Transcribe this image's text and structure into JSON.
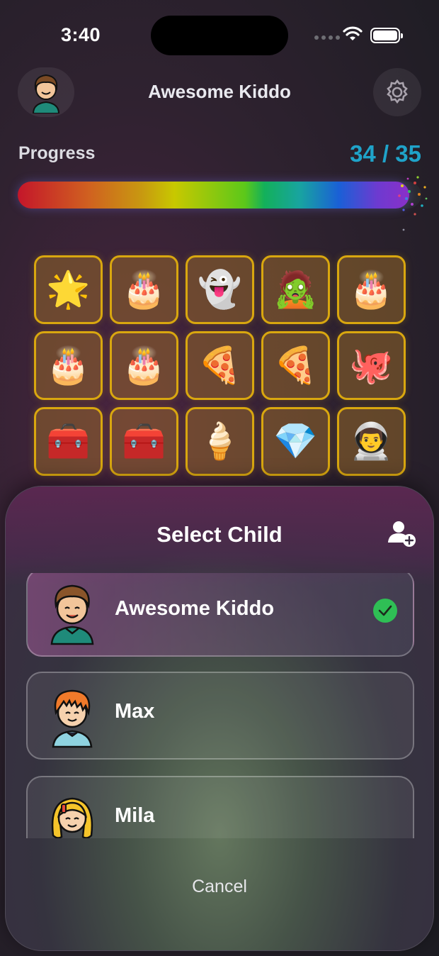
{
  "status_bar": {
    "time": "3:40"
  },
  "header": {
    "title": "Awesome Kiddo",
    "avatar_icon": "boy-avatar-icon",
    "settings_icon": "gear-icon"
  },
  "progress": {
    "label": "Progress",
    "count": "34 / 35",
    "value": 34,
    "total": 35,
    "fraction": 0.971
  },
  "stickers": [
    {
      "emoji": "🌟",
      "icon": "star-icon"
    },
    {
      "emoji": "🎂",
      "icon": "cake-icon"
    },
    {
      "emoji": "👻",
      "icon": "ghost-icon"
    },
    {
      "emoji": "🧟",
      "icon": "zombie-icon"
    },
    {
      "emoji": "🎂",
      "icon": "cake-icon"
    },
    {
      "emoji": "🎂",
      "icon": "cake-icon"
    },
    {
      "emoji": "🎂",
      "icon": "cake-icon"
    },
    {
      "emoji": "🍕",
      "icon": "pizza-icon"
    },
    {
      "emoji": "🍕",
      "icon": "pizza-icon"
    },
    {
      "emoji": "🐙",
      "icon": "octopus-icon"
    },
    {
      "emoji": "🧰",
      "icon": "treasure-chest-icon"
    },
    {
      "emoji": "🧰",
      "icon": "treasure-chest-icon"
    },
    {
      "emoji": "🍦",
      "icon": "ice-cream-icon"
    },
    {
      "emoji": "💎",
      "icon": "crystal-icon"
    },
    {
      "emoji": "👨‍🚀",
      "icon": "astronaut-icon"
    }
  ],
  "sheet": {
    "title": "Select Child",
    "add_icon": "add-person-icon",
    "children": [
      {
        "name": "Awesome Kiddo",
        "selected": true,
        "avatar": "boy-brown-hair-icon"
      },
      {
        "name": "Max",
        "selected": false,
        "avatar": "boy-orange-hair-icon"
      },
      {
        "name": "Mila",
        "selected": false,
        "avatar": "girl-blonde-hair-icon"
      }
    ],
    "cancel": "Cancel"
  },
  "colors": {
    "accent": "#1fa3c9",
    "tile_border": "#d9a70f",
    "check": "#2fbf55"
  }
}
